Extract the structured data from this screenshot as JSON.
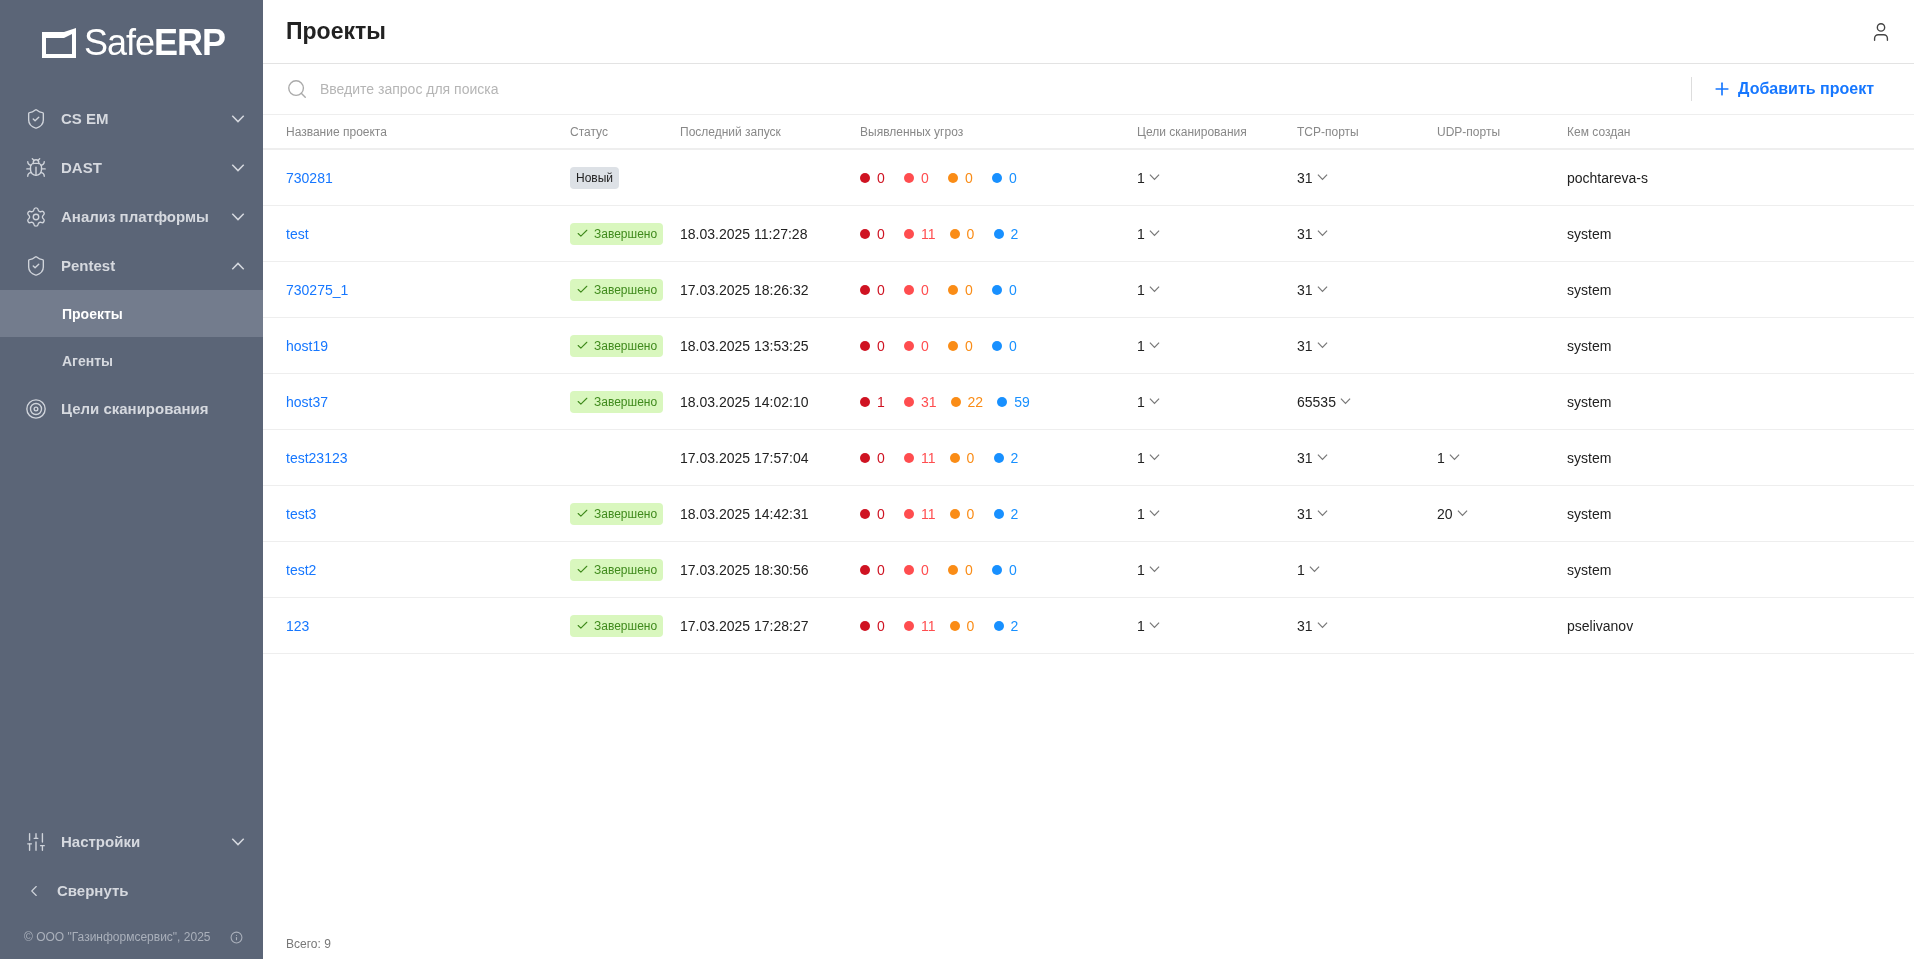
{
  "sidebar": {
    "logo": "Safe**ERP**",
    "items": [
      {
        "kind": "shield",
        "label": "CS EM",
        "expanded": false
      },
      {
        "kind": "dast",
        "label": "DAST",
        "expanded": false
      },
      {
        "kind": "gear",
        "label": "Анализ платформы",
        "expanded": false
      },
      {
        "kind": "shield",
        "label": "Pentest",
        "expanded": true,
        "children": [
          {
            "label": "Проекты",
            "selected": true
          },
          {
            "label": "Агенты",
            "selected": false
          }
        ]
      },
      {
        "kind": "target",
        "label": "Цели сканирования"
      }
    ],
    "bottom": [
      {
        "kind": "sliders",
        "label": "Настройки",
        "expanded": false
      },
      {
        "kind": "collapse",
        "label": "Свернуть"
      }
    ],
    "copyright": "© ООО \"Газинформсервис\", 2025"
  },
  "header": {
    "title": "Проекты"
  },
  "search": {
    "placeholder": "Введите запрос для поиска"
  },
  "add_button": "Добавить проект",
  "table": {
    "columns": [
      "Название проекта",
      "Статус",
      "Последний запуск",
      "Выявленных угроз",
      "Цели сканирования",
      "TCP-порты",
      "UDP-порты",
      "Кем создан"
    ],
    "rows": [
      {
        "name": "730281",
        "status": {
          "kind": "new",
          "label": "Новый"
        },
        "threats": [
          {
            "count": "0",
            "color": "#cf1322"
          },
          {
            "count": "0",
            "color": "#ff4d4f"
          },
          {
            "count": "0",
            "color": "#fa8c16"
          },
          {
            "count": "0",
            "color": "#1890ff"
          }
        ],
        "targets": "1",
        "tcp": "31",
        "author": "pochtareva-s"
      },
      {
        "name": "test",
        "status": {
          "kind": "done",
          "label": "Завершено"
        },
        "last_run": "18.03.2025 11:27:28",
        "threats": [
          {
            "count": "0",
            "color": "#cf1322"
          },
          {
            "count": "11",
            "color": "#ff4d4f"
          },
          {
            "count": "0",
            "color": "#fa8c16"
          },
          {
            "count": "2",
            "color": "#1890ff"
          }
        ],
        "targets": "1",
        "tcp": "31",
        "author": "system"
      },
      {
        "name": "730275_1",
        "status": {
          "kind": "done",
          "label": "Завершено"
        },
        "last_run": "17.03.2025 18:26:32",
        "threats": [
          {
            "count": "0",
            "color": "#cf1322"
          },
          {
            "count": "0",
            "color": "#ff4d4f"
          },
          {
            "count": "0",
            "color": "#fa8c16"
          },
          {
            "count": "0",
            "color": "#1890ff"
          }
        ],
        "targets": "1",
        "tcp": "31",
        "author": "system"
      },
      {
        "name": "host19",
        "status": {
          "kind": "done",
          "label": "Завершено"
        },
        "last_run": "18.03.2025 13:53:25",
        "threats": [
          {
            "count": "0",
            "color": "#cf1322"
          },
          {
            "count": "0",
            "color": "#ff4d4f"
          },
          {
            "count": "0",
            "color": "#fa8c16"
          },
          {
            "count": "0",
            "color": "#1890ff"
          }
        ],
        "targets": "1",
        "tcp": "31",
        "author": "system"
      },
      {
        "name": "host37",
        "status": {
          "kind": "done",
          "label": "Завершено"
        },
        "last_run": "18.03.2025 14:02:10",
        "threats": [
          {
            "count": "1",
            "color": "#cf1322"
          },
          {
            "count": "31",
            "color": "#ff4d4f"
          },
          {
            "count": "22",
            "color": "#fa8c16"
          },
          {
            "count": "59",
            "color": "#1890ff"
          }
        ],
        "targets": "1",
        "tcp": "65535",
        "author": "system"
      },
      {
        "name": "test23123",
        "last_run": "17.03.2025 17:57:04",
        "threats": [
          {
            "count": "0",
            "color": "#cf1322"
          },
          {
            "count": "11",
            "color": "#ff4d4f"
          },
          {
            "count": "0",
            "color": "#fa8c16"
          },
          {
            "count": "2",
            "color": "#1890ff"
          }
        ],
        "targets": "1",
        "tcp": "31",
        "udp": "1",
        "author": "system"
      },
      {
        "name": "test3",
        "status": {
          "kind": "done",
          "label": "Завершено"
        },
        "last_run": "18.03.2025 14:42:31",
        "threats": [
          {
            "count": "0",
            "color": "#cf1322"
          },
          {
            "count": "11",
            "color": "#ff4d4f"
          },
          {
            "count": "0",
            "color": "#fa8c16"
          },
          {
            "count": "2",
            "color": "#1890ff"
          }
        ],
        "targets": "1",
        "tcp": "31",
        "udp": "20",
        "author": "system"
      },
      {
        "name": "test2",
        "status": {
          "kind": "done",
          "label": "Завершено"
        },
        "last_run": "17.03.2025 18:30:56",
        "threats": [
          {
            "count": "0",
            "color": "#cf1322"
          },
          {
            "count": "0",
            "color": "#ff4d4f"
          },
          {
            "count": "0",
            "color": "#fa8c16"
          },
          {
            "count": "0",
            "color": "#1890ff"
          }
        ],
        "targets": "1",
        "tcp": "1",
        "author": "system"
      },
      {
        "name": "123",
        "status": {
          "kind": "done",
          "label": "Завершено"
        },
        "last_run": "17.03.2025 17:28:27",
        "threats": [
          {
            "count": "0",
            "color": "#cf1322"
          },
          {
            "count": "11",
            "color": "#ff4d4f"
          },
          {
            "count": "0",
            "color": "#fa8c16"
          },
          {
            "count": "2",
            "color": "#1890ff"
          }
        ],
        "targets": "1",
        "tcp": "31",
        "author": "pselivanov"
      }
    ]
  },
  "total": "Всего: 9"
}
